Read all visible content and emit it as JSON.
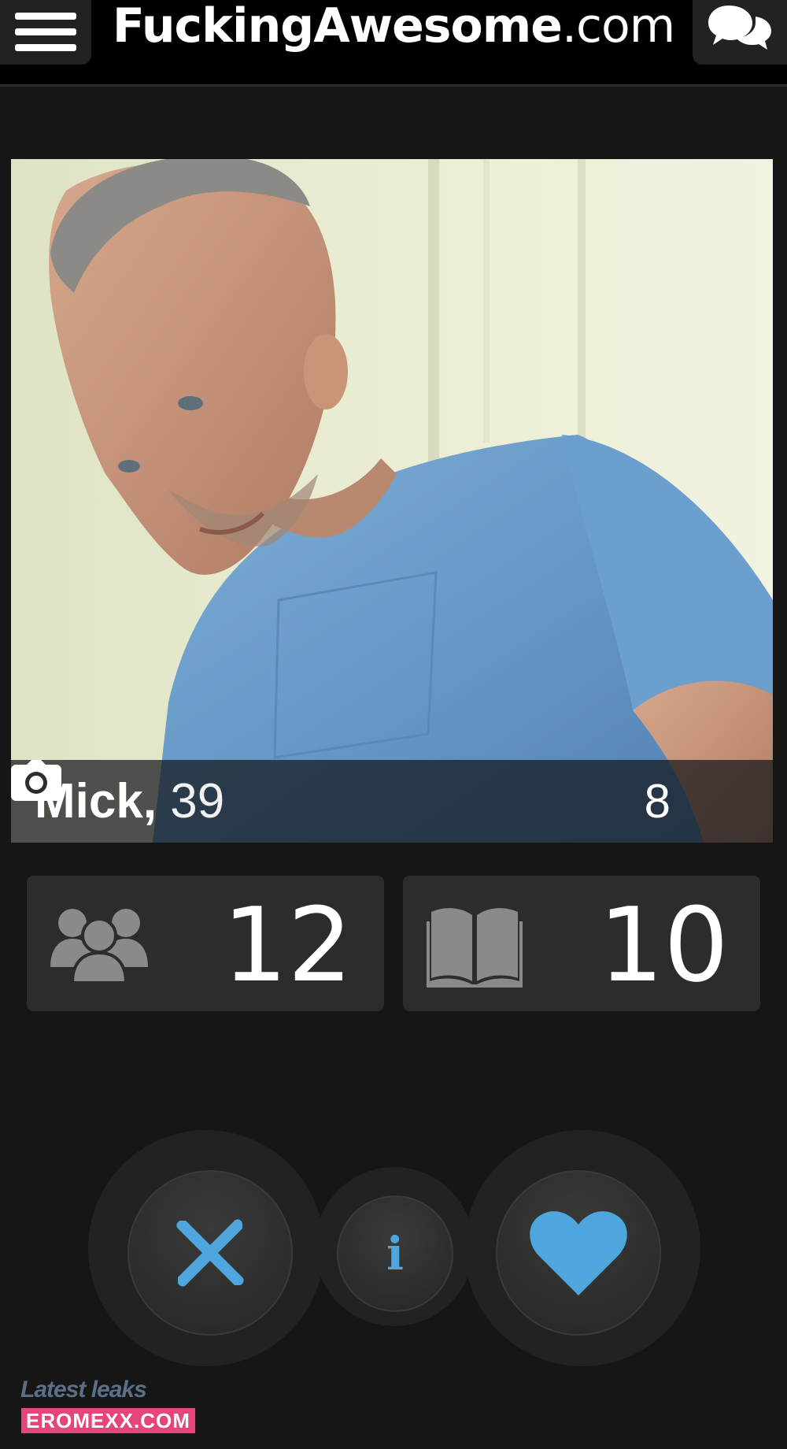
{
  "header": {
    "brand_bold": "FuckingAwesome",
    "brand_rest": ".com",
    "menu_icon": "hamburger-menu-icon",
    "chat_icon": "chat-bubbles-icon"
  },
  "profile": {
    "name": "Mick,",
    "age": "39",
    "photo_count": "8",
    "camera_icon": "camera-icon"
  },
  "stats": {
    "friends_count": "12",
    "friends_icon": "group-icon",
    "stories_count": "10",
    "stories_icon": "open-book-icon"
  },
  "actions": {
    "dislike_icon": "close-x-icon",
    "info_label": "i",
    "like_icon": "heart-icon"
  },
  "watermark": {
    "line1": "Latest leaks",
    "line2": "EROMEXX.COM"
  },
  "colors": {
    "background": "#161616",
    "header": "#000000",
    "tile": "#2c2c2c",
    "accent": "#4ea6dc",
    "shirt": "#6a9cc9"
  }
}
